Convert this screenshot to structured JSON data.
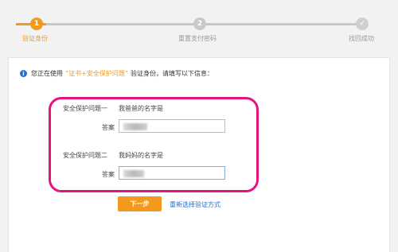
{
  "stepper": {
    "steps": [
      {
        "number": "1",
        "label": "验证身份",
        "state": "active"
      },
      {
        "number": "2",
        "label": "重置支付密码",
        "state": "pending"
      },
      {
        "number": "✓",
        "label": "找回成功",
        "state": "pending"
      }
    ]
  },
  "notice": {
    "prefix": "您正在使用",
    "method": "“证书+安全保护问题”",
    "suffix": "验证身份，请填写以下信息："
  },
  "security_questions": [
    {
      "question_label": "安全保护问题一",
      "question_text": "我爸爸的名字是",
      "answer_label": "答案"
    },
    {
      "question_label": "安全保护问题二",
      "question_text": "我妈妈的名字是",
      "answer_label": "答案"
    }
  ],
  "actions": {
    "next_label": "下一步",
    "reselect_label": "重新选择验证方式"
  },
  "colors": {
    "accent": "#f29a1f",
    "highlight": "#e6137e",
    "link": "#2b6fc6"
  }
}
